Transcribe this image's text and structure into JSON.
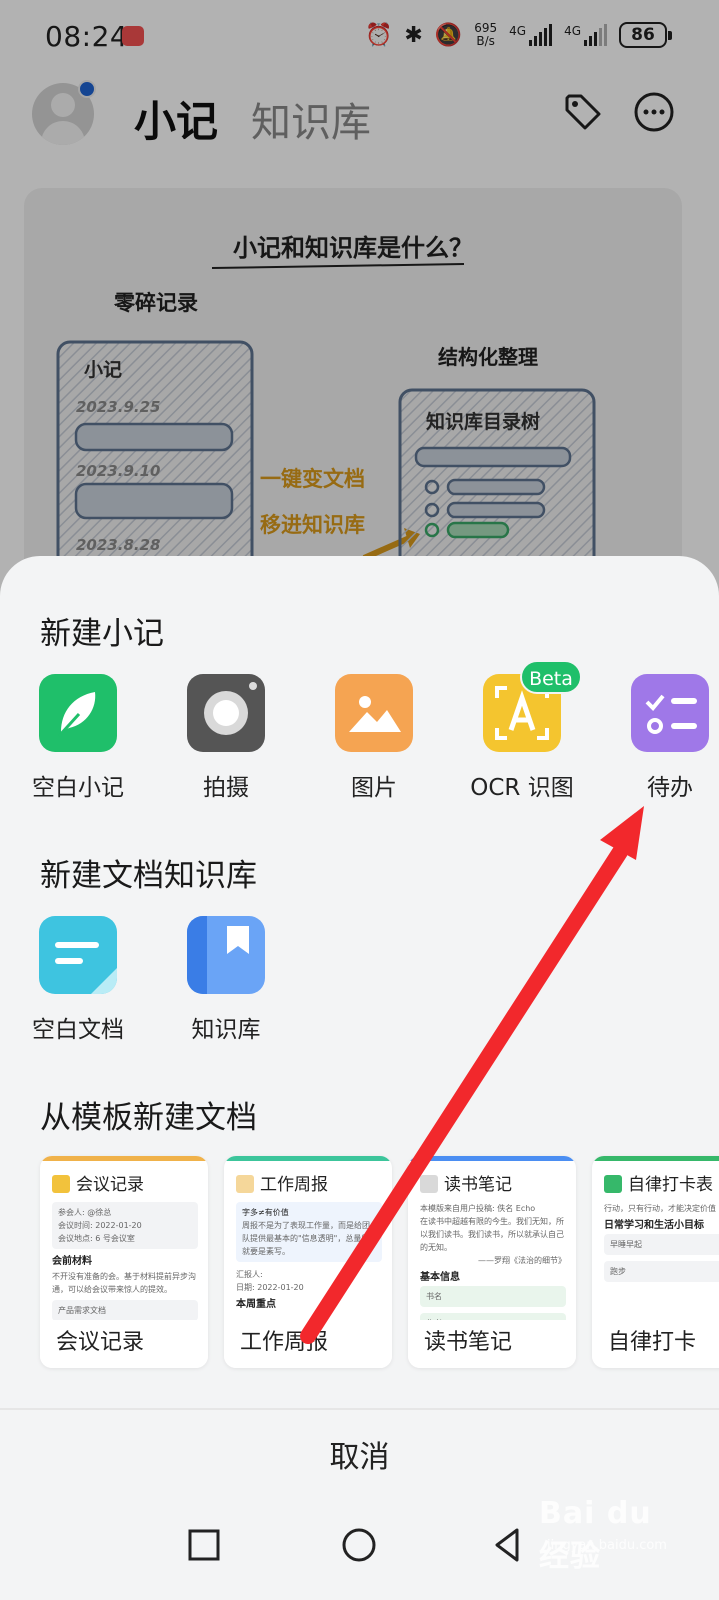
{
  "status_bar": {
    "time": "08:24",
    "net_speed_value": "695",
    "net_speed_unit": "B/s",
    "signal1_label": "4G",
    "signal2_label": "4G",
    "battery": "86"
  },
  "header": {
    "tab_active": "小记",
    "tab_inactive": "知识库"
  },
  "intro_card": {
    "title": "小记和知识库是什么？",
    "left_caption": "零碎记录",
    "left_box_title": "小记",
    "dates": [
      "2023.9.25",
      "2023.9.10",
      "2023.8.28"
    ],
    "middle_line1": "一键变文档",
    "middle_line2": "移进知识库",
    "right_caption": "结构化整理",
    "right_box_title": "知识库目录树"
  },
  "sheet": {
    "new_note_title": "新建小记",
    "new_note_items": [
      {
        "label": "空白小记",
        "icon": "feather-icon",
        "color": "#1fbf6a"
      },
      {
        "label": "拍摄",
        "icon": "camera-icon",
        "color": "#555555"
      },
      {
        "label": "图片",
        "icon": "image-icon",
        "color": "#f5a452"
      },
      {
        "label": "OCR 识图",
        "icon": "ocr-icon",
        "color": "#f4c52f",
        "badge": "Beta"
      },
      {
        "label": "待办",
        "icon": "todo-icon",
        "color": "#9f78e8"
      }
    ],
    "new_doc_title": "新建文档知识库",
    "new_doc_items": [
      {
        "label": "空白文档",
        "icon": "document-icon",
        "color": "#3ec4e0"
      },
      {
        "label": "知识库",
        "icon": "book-icon",
        "color": "#4b8ef2"
      }
    ],
    "template_title": "从模板新建文档",
    "templates": [
      {
        "header": "会议记录",
        "footer": "会议记录",
        "accent": "#f0b24a",
        "lines": [
          "参会人: @徐总",
          "会议时间: 2022-01-20",
          "会议地点: 6 号会议室"
        ],
        "section": "会前材料",
        "body": "不开没有准备的会。基于材料提前异步沟通，可以给会议带来惊人的提效。",
        "extra": "产品需求文档"
      },
      {
        "header": "工作周报",
        "footer": "工作周报",
        "accent": "#3cc59b",
        "lines": [
          "字多≠有价值",
          "周报不是为了表现工作量，而是给团队提供最基本的\"信息透明\"，总量能就要是素写。"
        ],
        "section": "汇报人:",
        "body": "日期: 2022-01-20",
        "extra": "本周重点"
      },
      {
        "header": "读书笔记",
        "footer": "读书笔记",
        "accent": "#4b8ef2",
        "lines": [
          "本模版来自用户投稿: 佚名 Echo",
          "在读书中超越有限的今生。我们无知，所以我们读书。我们读书，所以就承认自己的无知。",
          "——罗翔《法治的细节》"
        ],
        "section": "基本信息",
        "body": "书名",
        "extra": "作者"
      },
      {
        "header": "自律打卡表",
        "footer": "自律打卡",
        "accent": "#36b86a",
        "lines": [
          "行动，只有行动，才能决定价值"
        ],
        "section": "日常学习和生活小目标",
        "body": "早睡早起",
        "extra": "跑步"
      }
    ],
    "cancel": "取消"
  },
  "watermark": {
    "main": "Bai du 经验",
    "sub": "jingyan.baidu.com"
  }
}
